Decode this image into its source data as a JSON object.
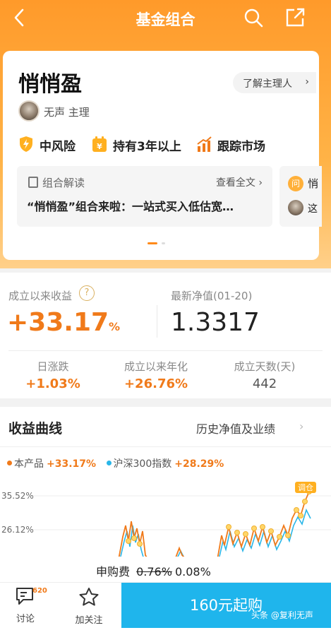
{
  "topbar": {
    "title": "基金组合"
  },
  "card": {
    "name": "悄悄盈",
    "manager_button": "了解主理人",
    "author": "无声 主理",
    "tags": [
      "中风险",
      "持有3年以上",
      "跟踪市场"
    ],
    "reading": {
      "label": "组合解读",
      "more": "查看全文",
      "text": "“悄悄盈”组合来啦：一站式买入低估宽…"
    },
    "peek": {
      "q": "问",
      "t1": "悄",
      "t2": "这"
    }
  },
  "stats": {
    "cumulative_label": "成立以来收益",
    "help": "?",
    "cumulative_value": "+33.17",
    "cumulative_unit": "%",
    "nav_label": "最新净值(01-20)",
    "nav_value": "1.3317",
    "daily_label": "日涨跌",
    "daily_value": "+1.03%",
    "annual_label": "成立以来年化",
    "annual_value": "+26.76%",
    "days_label": "成立天数(天)",
    "days_value": "442"
  },
  "curve": {
    "title": "收益曲线",
    "history_link": "历史净值及业绩",
    "legend": [
      {
        "name": "本产品",
        "value": "+33.17%",
        "color": "#f07a1a"
      },
      {
        "name": "沪深300指数",
        "value": "+28.29%",
        "color": "#29b6e8"
      }
    ],
    "y_ticks": [
      "35.52%",
      "26.12%"
    ],
    "end_tag": "调仓"
  },
  "fee": {
    "label": "申购费",
    "old": "0.76%",
    "new": "0.08%"
  },
  "bottom": {
    "discuss": "讨论",
    "discuss_count": "620",
    "follow": "加关注",
    "buy": "160元起购"
  },
  "watermark": "头条 @复利无声",
  "colors": {
    "accent": "#f07a1a",
    "buy": "#1fb5ec",
    "hero": "#ff9a2a"
  }
}
